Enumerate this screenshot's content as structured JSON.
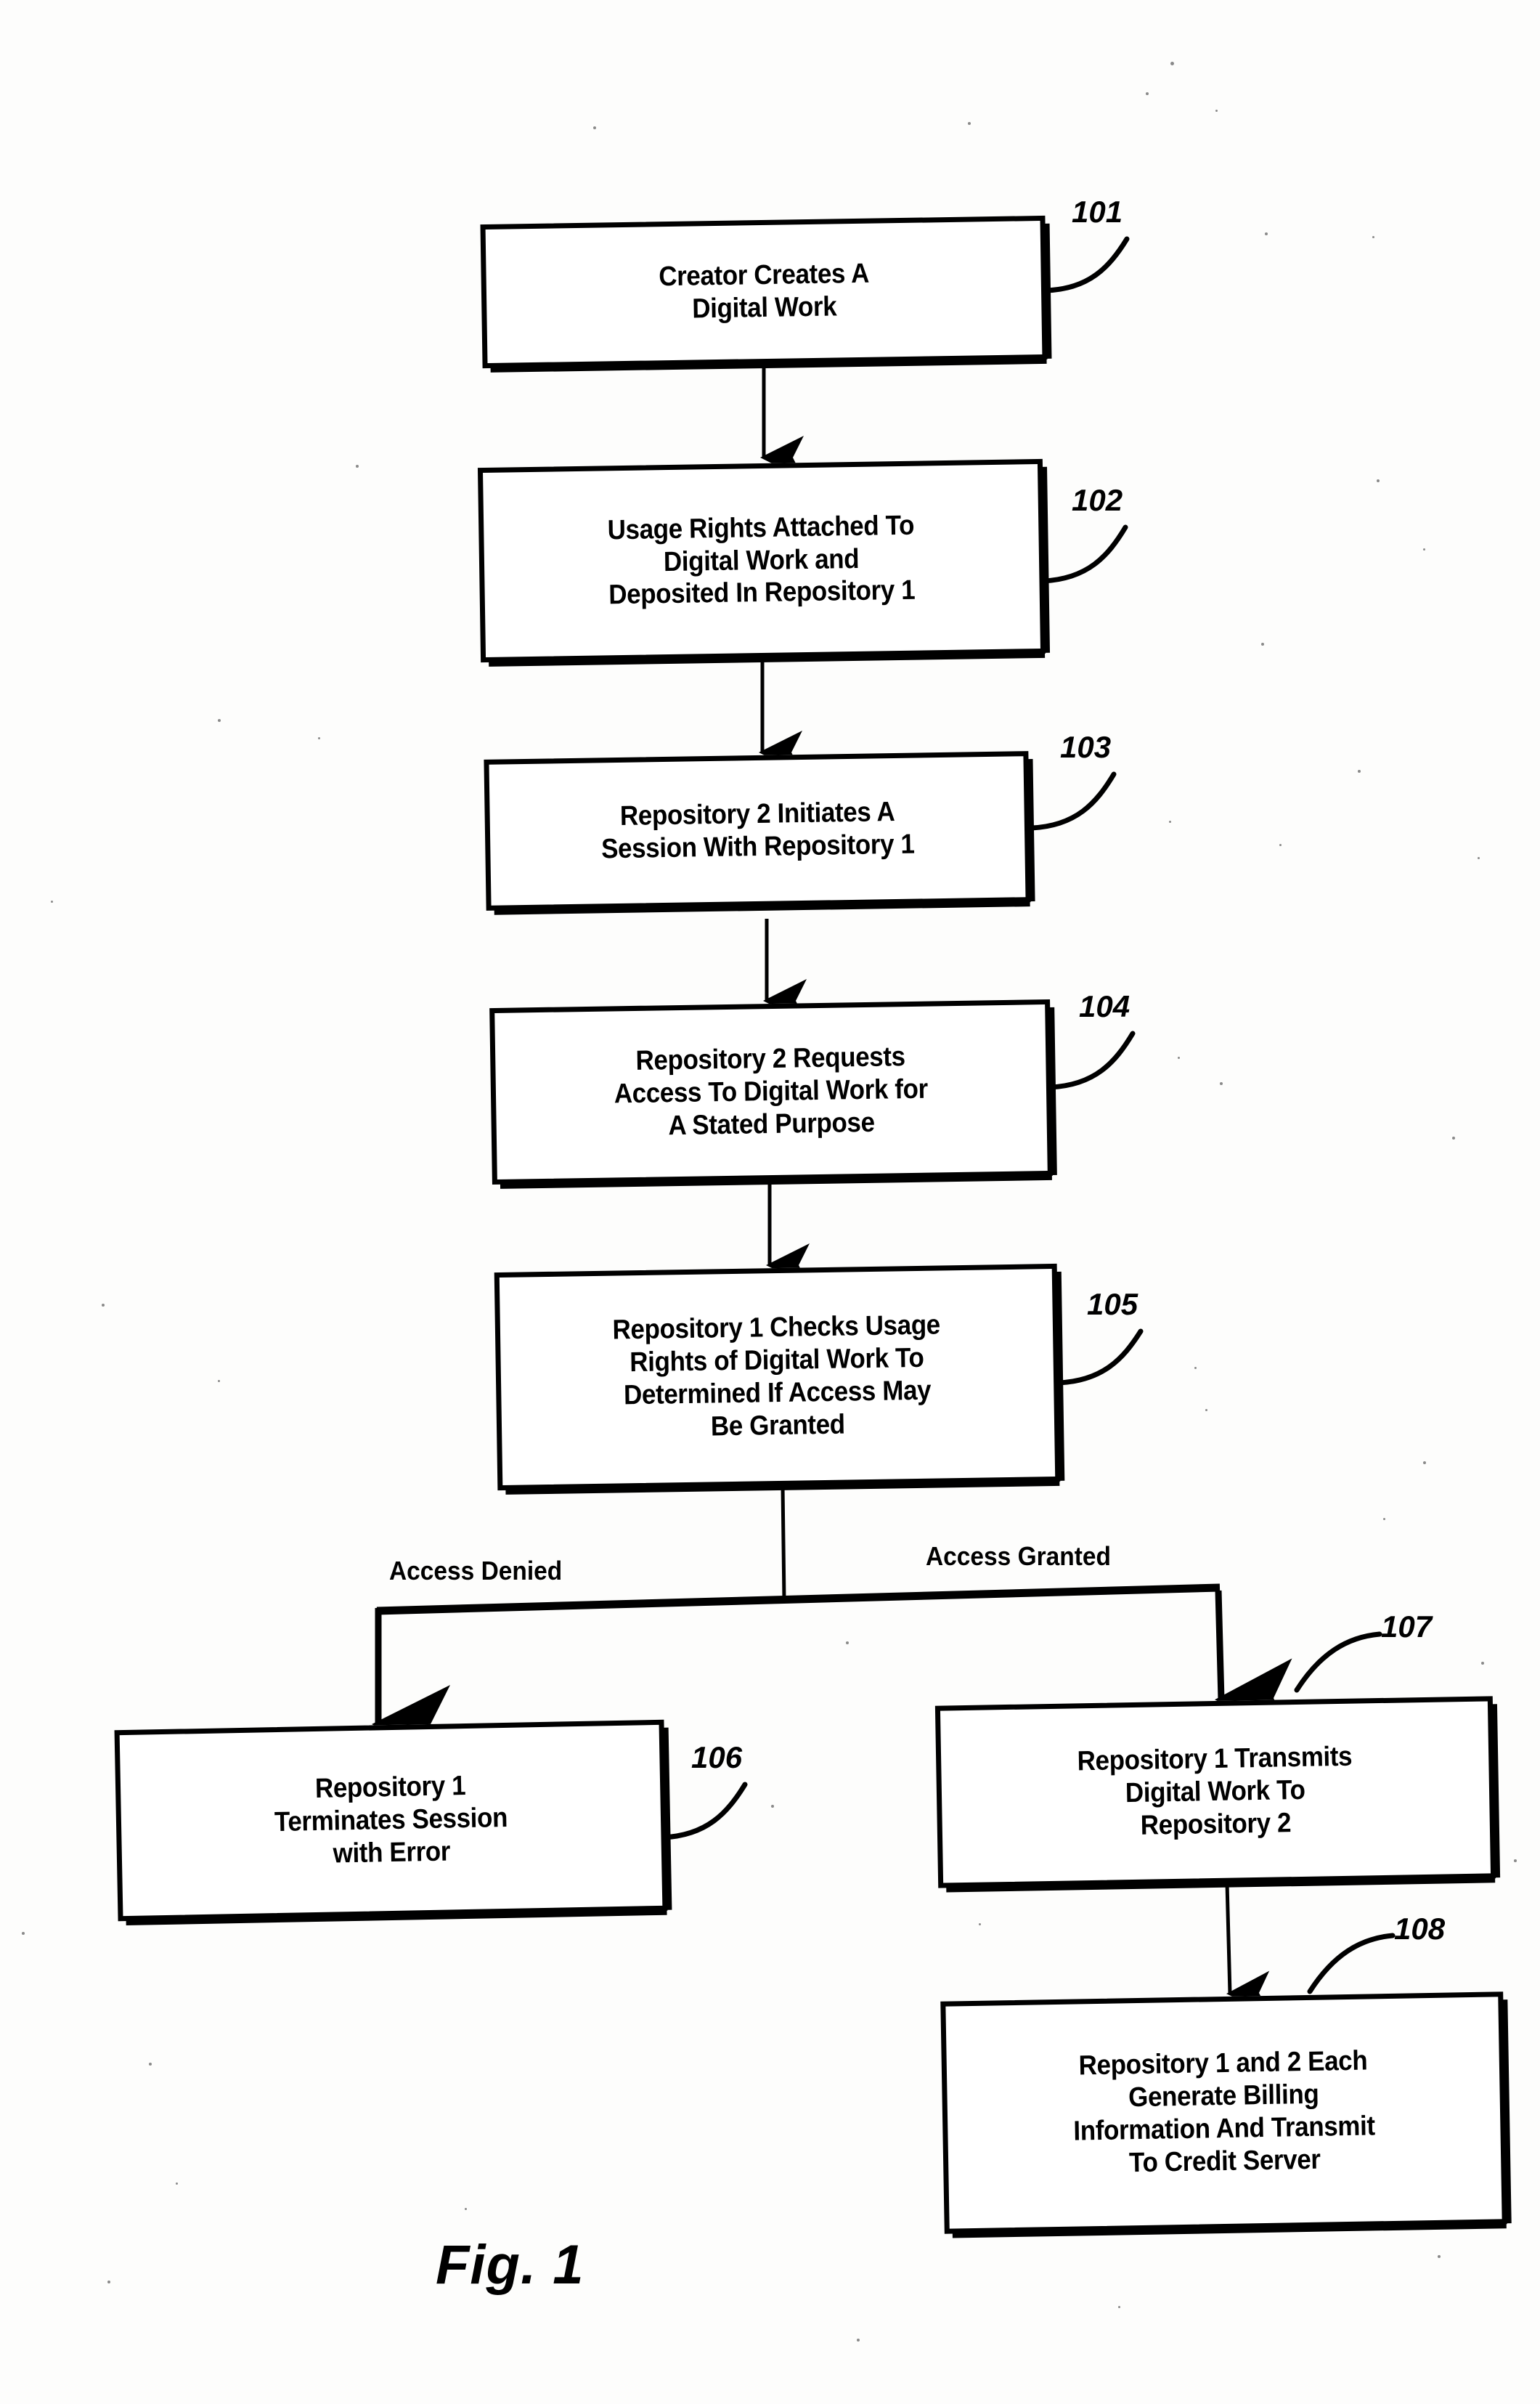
{
  "figure": {
    "caption": "Fig. 1",
    "type": "patent-flowchart"
  },
  "chart_data": {
    "type": "diagram",
    "title": "Fig. 1",
    "nodes": [
      {
        "ref": "101",
        "text": "Creator Creates A\nDigital Work"
      },
      {
        "ref": "102",
        "text": "Usage Rights Attached To\nDigital Work and\nDeposited In Repository 1"
      },
      {
        "ref": "103",
        "text": "Repository 2 Initiates A\nSession With Repository 1"
      },
      {
        "ref": "104",
        "text": "Repository 2 Requests\nAccess To Digital Work for\nA Stated Purpose"
      },
      {
        "ref": "105",
        "text": "Repository 1 Checks Usage\nRights of Digital Work To\nDetermined If Access May\nBe Granted"
      },
      {
        "ref": "106",
        "text": "Repository 1\nTerminates Session\nwith Error"
      },
      {
        "ref": "107",
        "text": "Repository 1 Transmits\nDigital Work To\nRepository 2"
      },
      {
        "ref": "108",
        "text": "Repository 1 and 2 Each\nGenerate Billing\nInformation And Transmit\nTo Credit Server"
      }
    ],
    "edges": [
      {
        "from": "101",
        "to": "102",
        "label": ""
      },
      {
        "from": "102",
        "to": "103",
        "label": ""
      },
      {
        "from": "103",
        "to": "104",
        "label": ""
      },
      {
        "from": "104",
        "to": "105",
        "label": ""
      },
      {
        "from": "105",
        "to": "106",
        "label": "Access Denied"
      },
      {
        "from": "105",
        "to": "107",
        "label": "Access Granted"
      },
      {
        "from": "107",
        "to": "108",
        "label": ""
      }
    ],
    "branch_labels": [
      "Access Denied",
      "Access Granted"
    ]
  },
  "boxes": {
    "b101": {
      "ref": "101",
      "text": "Creator Creates A\nDigital Work"
    },
    "b102": {
      "ref": "102",
      "text": "Usage Rights Attached To\nDigital Work and\nDeposited In Repository 1"
    },
    "b103": {
      "ref": "103",
      "text": "Repository 2 Initiates A\nSession With Repository 1"
    },
    "b104": {
      "ref": "104",
      "text": "Repository 2 Requests\nAccess To Digital Work for\nA Stated Purpose"
    },
    "b105": {
      "ref": "105",
      "text": "Repository 1 Checks Usage\nRights of Digital Work To\nDetermined If Access May\nBe Granted"
    },
    "b106": {
      "ref": "106",
      "text": "Repository 1\nTerminates Session\nwith Error"
    },
    "b107": {
      "ref": "107",
      "text": "Repository 1 Transmits\nDigital Work To\nRepository 2"
    },
    "b108": {
      "ref": "108",
      "text": "Repository 1 and 2 Each\nGenerate Billing\nInformation And Transmit\nTo Credit Server"
    }
  },
  "labels": {
    "access_denied": "Access Denied",
    "access_granted": "Access Granted"
  },
  "colors": {
    "ink": "#000000",
    "paper": "#fdfdfc"
  }
}
